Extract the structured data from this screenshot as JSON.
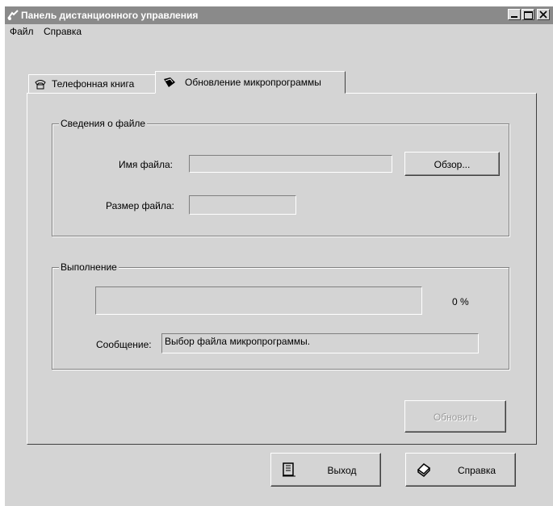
{
  "window": {
    "title": "Панель дистанционного управления",
    "minimize_icon": "minimize-icon",
    "maximize_icon": "maximize-icon",
    "close_icon": "close-icon"
  },
  "menu": {
    "items": [
      "Файл",
      "Справка"
    ]
  },
  "tabs": [
    {
      "label": "Телефонная книга",
      "icon": "phonebook-icon",
      "active": false
    },
    {
      "label": "Обновление микропрограммы",
      "icon": "firmware-icon",
      "active": true
    }
  ],
  "file_info": {
    "group_label": "Сведения о файле",
    "name_label": "Имя файла:",
    "name_value": "",
    "size_label": "Размер файла:",
    "size_value": "",
    "browse_label": "Обзор..."
  },
  "progress": {
    "group_label": "Выполнение",
    "percent_text": "0 %",
    "percent_value": 0,
    "message_label": "Сообщение:",
    "message_value": "Выбор файла микропрограммы."
  },
  "update_button": {
    "label": "Обновить",
    "enabled": false
  },
  "footer": {
    "exit_label": "Выход",
    "exit_icon": "exit-door-icon",
    "help_label": "Справка",
    "help_icon": "help-book-icon"
  }
}
